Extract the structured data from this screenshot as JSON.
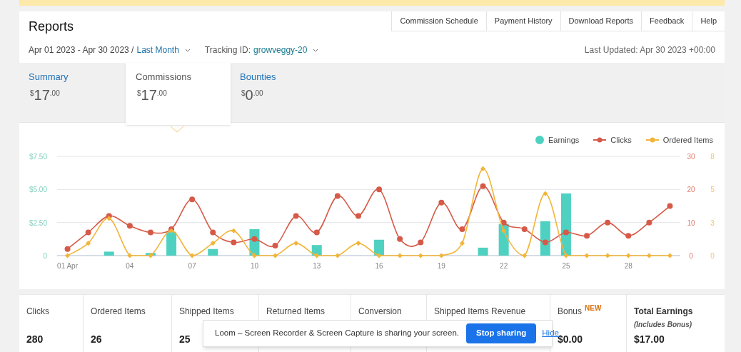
{
  "header": {
    "title": "Reports",
    "nav": [
      "Commission Schedule",
      "Payment History",
      "Download Reports",
      "Feedback",
      "Help"
    ]
  },
  "filters": {
    "date_range": "Apr 01 2023 - Apr 30 2023 /",
    "period": "Last Month",
    "tracking_label": "Tracking ID:",
    "tracking_id": "growveggy-20",
    "last_updated": "Last Updated: Apr 30 2023 +00:00"
  },
  "tabs": [
    {
      "label": "Summary",
      "currency": "$",
      "whole": "17",
      "cents": ".00",
      "selected": false
    },
    {
      "label": "Commissions",
      "currency": "$",
      "whole": "17",
      "cents": ".00",
      "selected": true
    },
    {
      "label": "Bounties",
      "currency": "$",
      "whole": "0",
      "cents": ".00",
      "selected": false
    }
  ],
  "chart": {
    "layers": [
      {
        "chart_data": {
          "type": "bar",
          "x": [
            3,
            5,
            6,
            8,
            10,
            13,
            16,
            21,
            22,
            24,
            25
          ],
          "xlim": [
            0.5,
            30.5
          ],
          "ylim": [
            0,
            7.5
          ],
          "yticks": [
            {
              "value": 0,
              "label": "0"
            },
            {
              "value": 2.5,
              "label": "$2.50"
            },
            {
              "value": 5,
              "label": "$5.00"
            },
            {
              "value": 7.5,
              "label": "$7.50"
            }
          ],
          "series": [
            {
              "name": "Earnings",
              "color": "#4fd1c1",
              "values": [
                0.3,
                0.2,
                1.8,
                0.5,
                2.0,
                0.8,
                1.2,
                0.6,
                2.4,
                2.6,
                4.7
              ]
            }
          ]
        }
      },
      {
        "chart_data": {
          "type": "line",
          "x": [
            1,
            2,
            3,
            4,
            5,
            6,
            7,
            8,
            9,
            10,
            11,
            12,
            13,
            14,
            15,
            16,
            17,
            18,
            19,
            20,
            21,
            22,
            23,
            24,
            25,
            26,
            27,
            28,
            29,
            30
          ],
          "xlim": [
            0.5,
            30.5
          ],
          "ylim": [
            0,
            30
          ],
          "xticks": [
            {
              "value": 1,
              "label": "01 Apr"
            },
            {
              "value": 4,
              "label": "04"
            },
            {
              "value": 7,
              "label": "07"
            },
            {
              "value": 10,
              "label": "10"
            },
            {
              "value": 13,
              "label": "13"
            },
            {
              "value": 16,
              "label": "16"
            },
            {
              "value": 19,
              "label": "19"
            },
            {
              "value": 22,
              "label": "22"
            },
            {
              "value": 25,
              "label": "25"
            },
            {
              "value": 28,
              "label": "28"
            }
          ],
          "yticks": [
            0,
            10,
            20,
            30
          ],
          "series": [
            {
              "name": "Clicks",
              "color": "#d65a48",
              "marker": "circle",
              "values": [
                2,
                7,
                12,
                9,
                7,
                8,
                17,
                7,
                4,
                5,
                3,
                12,
                7,
                18,
                12,
                20,
                5,
                4,
                16,
                8,
                21,
                10,
                8,
                4,
                7,
                6,
                10,
                6,
                10,
                15
              ]
            }
          ]
        }
      },
      {
        "chart_data": {
          "type": "line",
          "x": [
            1,
            2,
            3,
            4,
            5,
            6,
            7,
            8,
            9,
            10,
            11,
            12,
            13,
            14,
            15,
            16,
            17,
            18,
            19,
            20,
            21,
            22,
            23,
            24,
            25,
            26,
            27,
            28,
            29,
            30
          ],
          "xlim": [
            0.5,
            30.5
          ],
          "ylim": [
            0,
            8
          ],
          "yticks": [
            0,
            {
              "value": 2.667,
              "label": "3"
            },
            {
              "value": 5.333,
              "label": "5"
            },
            8
          ],
          "series": [
            {
              "name": "Ordered Items",
              "color": "#f2b53a",
              "marker": "diamond",
              "values": [
                0,
                1,
                3,
                0,
                0,
                2,
                0,
                1,
                2,
                0,
                0,
                1,
                0,
                0,
                1,
                0,
                0,
                0,
                0,
                1,
                7,
                2,
                0,
                5,
                0,
                0,
                0,
                0,
                0,
                0
              ]
            }
          ]
        }
      }
    ]
  },
  "summary": [
    {
      "label": "Clicks",
      "value": "280"
    },
    {
      "label": "Ordered Items",
      "value": "26"
    },
    {
      "label": "Shipped Items",
      "value": "25"
    },
    {
      "label": "Returned Items"
    },
    {
      "label": "Conversion"
    },
    {
      "label": "Shipped Items Revenue"
    },
    {
      "label": "Bonus",
      "badge": "NEW",
      "value": "$0.00"
    },
    {
      "label": "Total Earnings",
      "note": "(Includes Bonus)",
      "value": "$17.00",
      "kind": "total"
    }
  ],
  "share_bar": {
    "message": "Loom – Screen Recorder & Screen Capture is sharing your screen.",
    "stop": "Stop sharing",
    "hide": "Hide"
  }
}
